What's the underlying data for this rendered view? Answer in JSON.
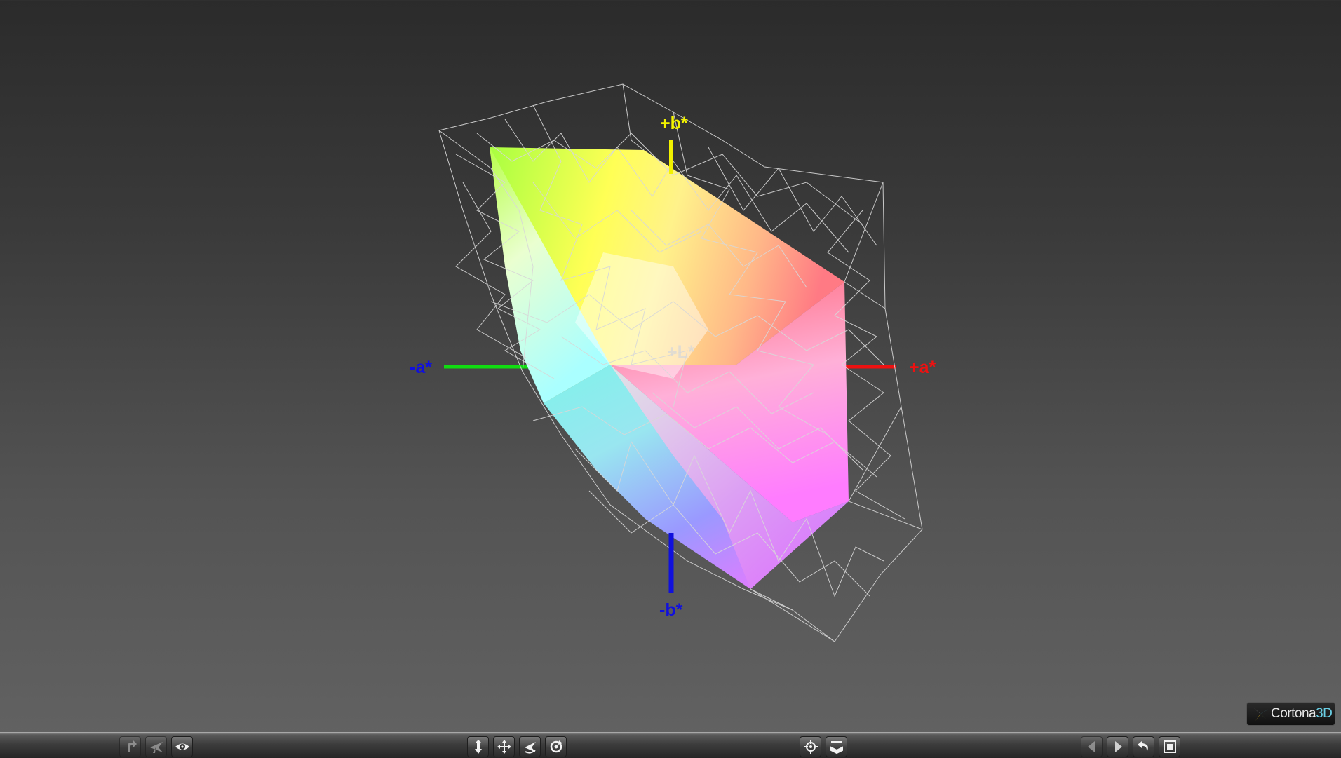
{
  "scene": {
    "axis_labels": {
      "plus_b": "+b*",
      "minus_b": "-b*",
      "plus_a": "+a*",
      "minus_a": "-a*",
      "plus_l": "+L*"
    },
    "colors": {
      "plus_b": "#f2f200",
      "minus_b": "#1010dd",
      "plus_a": "#ee1111",
      "minus_a_line": "#11dd11",
      "minus_a_label": "#1010dd",
      "wireframe": "#d8d8d8"
    }
  },
  "logo": {
    "brand": "Cortona",
    "brand_suffix": "3D"
  },
  "toolbar": {
    "left_group": [
      {
        "icon": "walk-icon",
        "state": "disabled"
      },
      {
        "icon": "fly-icon",
        "state": "disabled"
      },
      {
        "icon": "study-eye-icon",
        "state": "active"
      }
    ],
    "center_group": [
      {
        "icon": "plan-arrow-icon",
        "state": "active"
      },
      {
        "icon": "pan-icon",
        "state": "active"
      },
      {
        "icon": "turn-icon",
        "state": "active"
      },
      {
        "icon": "roll-icon",
        "state": "active"
      }
    ],
    "right_group": [
      {
        "icon": "goto-target-icon",
        "state": "active"
      },
      {
        "icon": "align-icon",
        "state": "active"
      }
    ],
    "nav_group": [
      {
        "icon": "prev-viewpoint-icon",
        "state": "disabled"
      },
      {
        "icon": "next-viewpoint-icon",
        "state": "active"
      },
      {
        "icon": "restore-icon",
        "state": "active"
      },
      {
        "icon": "fit-icon",
        "state": "active"
      }
    ]
  }
}
